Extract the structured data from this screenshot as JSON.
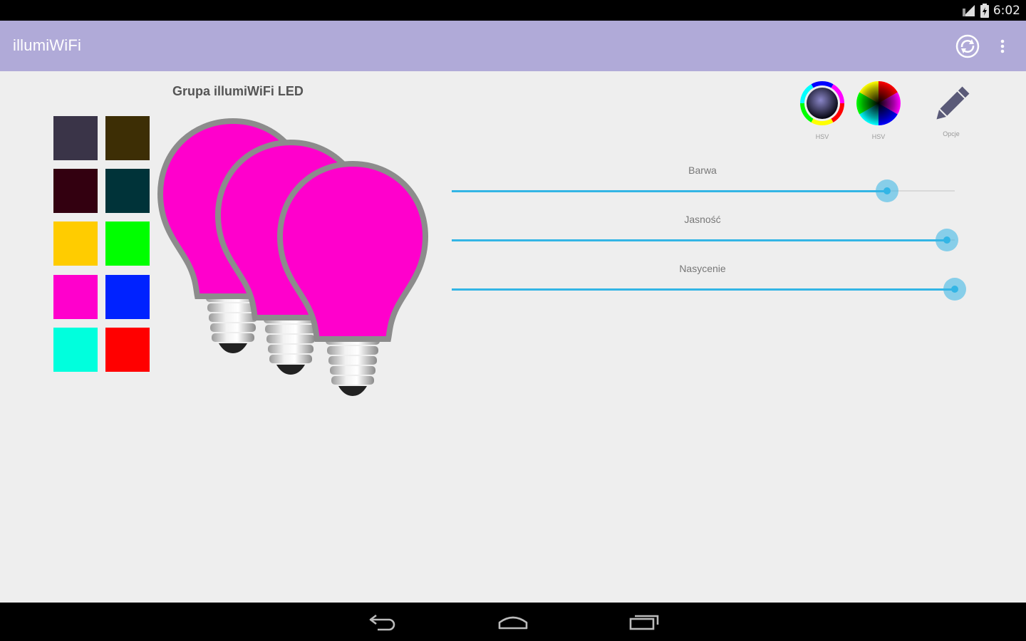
{
  "status_bar": {
    "time": "6:02",
    "icons": [
      "signal-icon",
      "battery-icon"
    ]
  },
  "app_bar": {
    "title": "illumiWiFi",
    "actions": [
      "sync-icon",
      "overflow-menu-icon"
    ]
  },
  "swatches": [
    {
      "color": "#3a3448"
    },
    {
      "color": "#3d2e05"
    },
    {
      "color": "#330010"
    },
    {
      "color": "#003339"
    },
    {
      "color": "#ffcc00"
    },
    {
      "color": "#00ff00"
    },
    {
      "color": "#ff00cc"
    },
    {
      "color": "#0022ff"
    },
    {
      "color": "#00ffdd"
    },
    {
      "color": "#ff0000"
    }
  ],
  "group": {
    "title": "Grupa illumiWiFi LED",
    "bulb_color": "#ff00cc"
  },
  "pickers": [
    {
      "label": "HSV",
      "icon": "hsv-ring-icon"
    },
    {
      "label": "HSV",
      "icon": "hsv-wheel-icon"
    },
    {
      "label": "Opcje",
      "icon": "pencil-icon"
    }
  ],
  "sliders": [
    {
      "label": "Barwa",
      "value": 0.865
    },
    {
      "label": "Jasność",
      "value": 0.985
    },
    {
      "label": "Nasycenie",
      "value": 1.0
    }
  ],
  "colors": {
    "accent": "#33b5e5",
    "app_bar": "#b0aad8"
  },
  "nav_bar": {
    "buttons": [
      "back-icon",
      "home-icon",
      "recents-icon"
    ]
  }
}
